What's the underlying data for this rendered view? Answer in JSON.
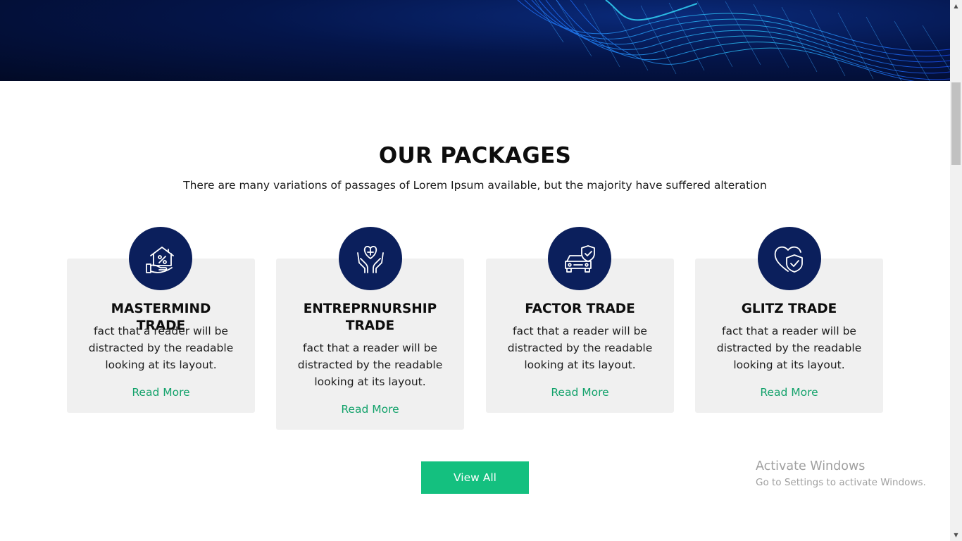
{
  "section": {
    "title": "OUR PACKAGES",
    "subtitle": "There are many variations of passages of Lorem Ipsum available, but the majority have suffered alteration"
  },
  "packages": [
    {
      "title": "MASTERMIND TRADE",
      "text": "fact that a reader will be distracted by the readable looking at its layout.",
      "link": "Read More",
      "icon": "house-hand-icon"
    },
    {
      "title": "ENTREPRNURSHIP TRADE",
      "text": "fact that a reader will be distracted by the readable looking at its layout.",
      "link": "Read More",
      "icon": "heart-hands-icon"
    },
    {
      "title": "FACTOR TRADE",
      "text": "fact that a reader will be distracted by the readable looking at its layout.",
      "link": "Read More",
      "icon": "car-shield-icon"
    },
    {
      "title": "GLITZ TRADE",
      "text": "fact that a reader will be distracted by the readable looking at its layout.",
      "link": "Read More",
      "icon": "heart-shield-icon"
    }
  ],
  "cta": {
    "label": "View All"
  },
  "watermark": {
    "line1": "Activate Windows",
    "line2": "Go to Settings to activate Windows."
  },
  "colors": {
    "accent_green": "#14c07f",
    "link_green": "#13a26b",
    "icon_navy": "#0b1f5c",
    "card_bg": "#f0f0f0"
  }
}
